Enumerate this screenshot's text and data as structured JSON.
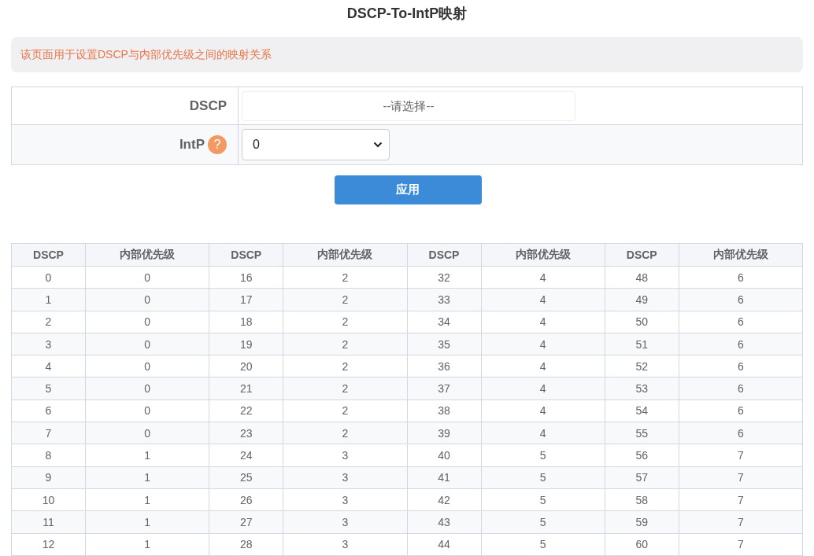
{
  "title": "DSCP-To-IntP映射",
  "notice": "该页面用于设置DSCP与内部优先级之间的映射关系",
  "form": {
    "dscp_label": "DSCP",
    "dscp_placeholder": "--请选择--",
    "intp_label": "IntP",
    "help": "?",
    "intp_value": "0"
  },
  "apply_button": "应用",
  "table": {
    "columns": [
      "DSCP",
      "内部优先级",
      "DSCP",
      "内部优先级",
      "DSCP",
      "内部优先级",
      "DSCP",
      "内部优先级"
    ],
    "rows": [
      [
        "0",
        "0",
        "16",
        "2",
        "32",
        "4",
        "48",
        "6"
      ],
      [
        "1",
        "0",
        "17",
        "2",
        "33",
        "4",
        "49",
        "6"
      ],
      [
        "2",
        "0",
        "18",
        "2",
        "34",
        "4",
        "50",
        "6"
      ],
      [
        "3",
        "0",
        "19",
        "2",
        "35",
        "4",
        "51",
        "6"
      ],
      [
        "4",
        "0",
        "20",
        "2",
        "36",
        "4",
        "52",
        "6"
      ],
      [
        "5",
        "0",
        "21",
        "2",
        "37",
        "4",
        "53",
        "6"
      ],
      [
        "6",
        "0",
        "22",
        "2",
        "38",
        "4",
        "54",
        "6"
      ],
      [
        "7",
        "0",
        "23",
        "2",
        "39",
        "4",
        "55",
        "6"
      ],
      [
        "8",
        "1",
        "24",
        "3",
        "40",
        "5",
        "56",
        "7"
      ],
      [
        "9",
        "1",
        "25",
        "3",
        "41",
        "5",
        "57",
        "7"
      ],
      [
        "10",
        "1",
        "26",
        "3",
        "42",
        "5",
        "58",
        "7"
      ],
      [
        "11",
        "1",
        "27",
        "3",
        "43",
        "5",
        "59",
        "7"
      ],
      [
        "12",
        "1",
        "28",
        "3",
        "44",
        "5",
        "60",
        "7"
      ]
    ]
  }
}
